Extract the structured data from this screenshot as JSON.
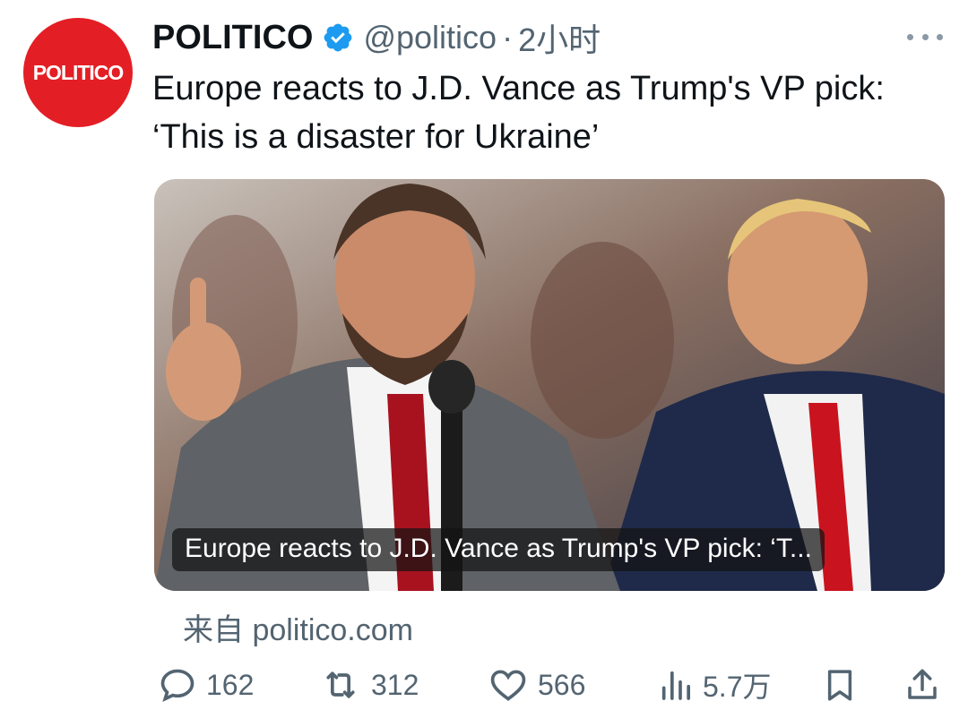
{
  "avatar": {
    "text": "POLITICO",
    "color": "#e41e25"
  },
  "header": {
    "name": "POLITICO",
    "handle": "@politico",
    "separator": "·",
    "time": "2小时",
    "verified_icon": "verified-badge-icon",
    "more_icon": "more-options-icon"
  },
  "tweet": {
    "line1": "Europe reacts to J.D. Vance as Trump's VP pick:",
    "line2": "‘This is a disaster for Ukraine’"
  },
  "card": {
    "caption": "Europe reacts to J.D. Vance as Trump's VP pick: ‘T...",
    "source": "来自 politico.com"
  },
  "actions": {
    "reply": {
      "icon": "reply-icon",
      "count": "162"
    },
    "retweet": {
      "icon": "retweet-icon",
      "count": "312"
    },
    "like": {
      "icon": "heart-icon",
      "count": "566"
    },
    "views": {
      "icon": "views-icon",
      "count": "5.7万"
    },
    "bookmark": {
      "icon": "bookmark-icon"
    },
    "share": {
      "icon": "share-icon"
    }
  },
  "colors": {
    "text": "#0f1419",
    "secondary": "#536471",
    "verified": "#1d9bf0",
    "brand": "#e41e25"
  }
}
